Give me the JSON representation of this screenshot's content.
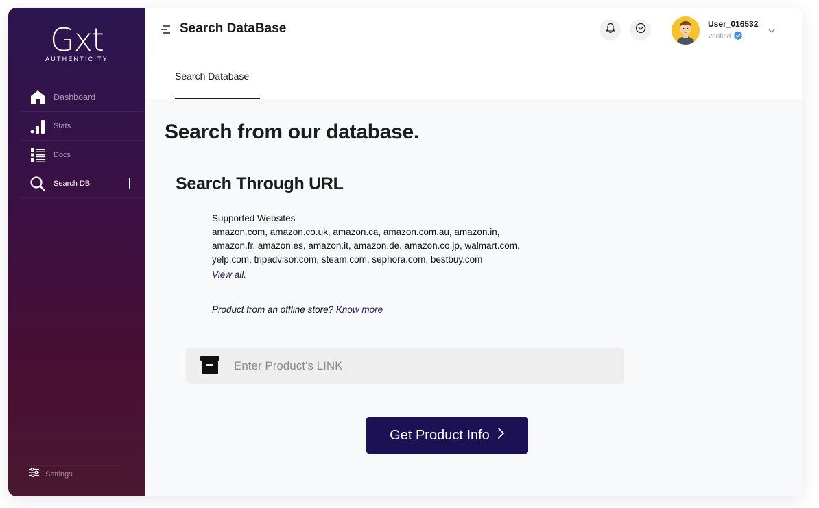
{
  "sidebar": {
    "logo": {
      "main": "Gxt",
      "sub": "AUTHENTICITY"
    },
    "items": [
      {
        "label": "Dashboard",
        "icon": "home-icon"
      },
      {
        "label": "Stats",
        "icon": "bar-chart-icon"
      },
      {
        "label": "Docs",
        "icon": "list-icon"
      },
      {
        "label": "Search DB",
        "icon": "search-icon",
        "active": true
      }
    ],
    "settings": {
      "label": "Settings",
      "icon": "sliders-icon"
    }
  },
  "header": {
    "title": "Search DataBase",
    "user": {
      "name": "User_016532",
      "status": "Verified"
    }
  },
  "tabs": [
    {
      "label": "Search Database",
      "active": true
    }
  ],
  "main": {
    "title": "Search from our database.",
    "subtitle": "Search Through URL",
    "supported_label": "Supported Websites",
    "supported_lines": [
      "amazon.com, amazon.co.uk, amazon.ca, amazon.com.au, amazon.in,",
      "amazon.fr, amazon.es, amazon.it, amazon.de, amazon.co.jp, walmart.com,",
      "yelp.com, tripadvisor.com, steam.com, sephora.com, bestbuy.com"
    ],
    "view_all": "View all.",
    "offline_text": "Product from an offline store?",
    "offline_link": "Know more",
    "input_placeholder": "Enter Product’s LINK",
    "cta_label": "Get Product Info"
  },
  "colors": {
    "sidebar_top": "#2b1650",
    "sidebar_bottom": "#4a1830",
    "cta": "#1d1155",
    "link": "#23164d",
    "verified": "#3b8ee0"
  }
}
